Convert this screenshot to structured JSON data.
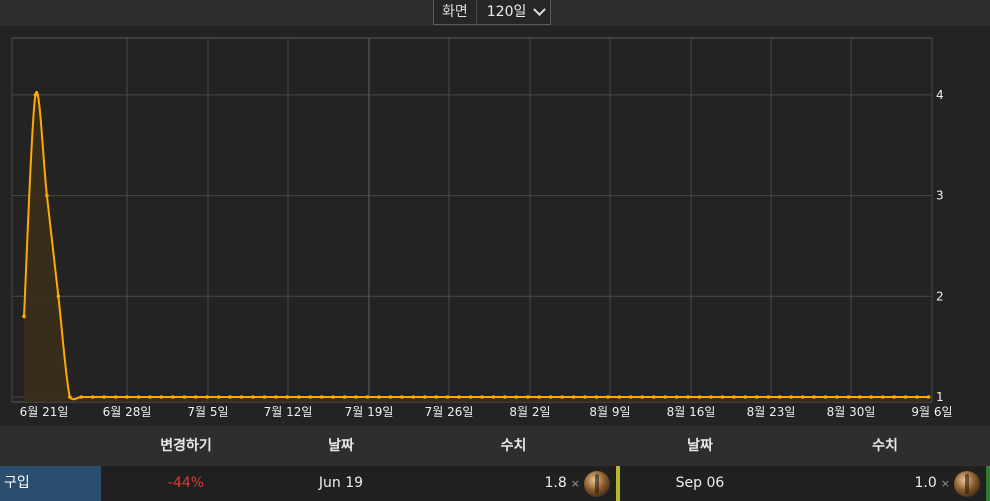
{
  "view": {
    "label": "화면",
    "selected": "120일"
  },
  "chart_data": {
    "type": "area",
    "x_ticks": [
      "6월 21일",
      "6월 28일",
      "7월 5일",
      "7월 12일",
      "7월 19일",
      "7월 26일",
      "8월 2일",
      "8월 9일",
      "8월 16일",
      "8월 23일",
      "8월 30일",
      "9월 6일"
    ],
    "y_ticks": [
      "1",
      "2",
      "3",
      "4"
    ],
    "ylim": [
      0.7,
      4.3
    ],
    "x_start": "2023-06-19",
    "x_end": "2023-09-06",
    "series": [
      {
        "values_by_day": [
          1.8,
          4.0,
          3.0,
          2.0,
          1.0
        ]
      }
    ],
    "colors": {
      "line": "#ffaa00",
      "fill": "#3a2f19",
      "grid": "#4a4a4a"
    }
  },
  "table": {
    "headers": {
      "change": "변경하기",
      "date1": "날짜",
      "value1": "수치",
      "date2": "날짜",
      "value2": "수치"
    },
    "row": {
      "type": "구입",
      "change": "-44%",
      "date1": "Jun 19",
      "value1": "1.8",
      "date2": "Sep 06",
      "value2": "1.0",
      "times": "×"
    }
  }
}
